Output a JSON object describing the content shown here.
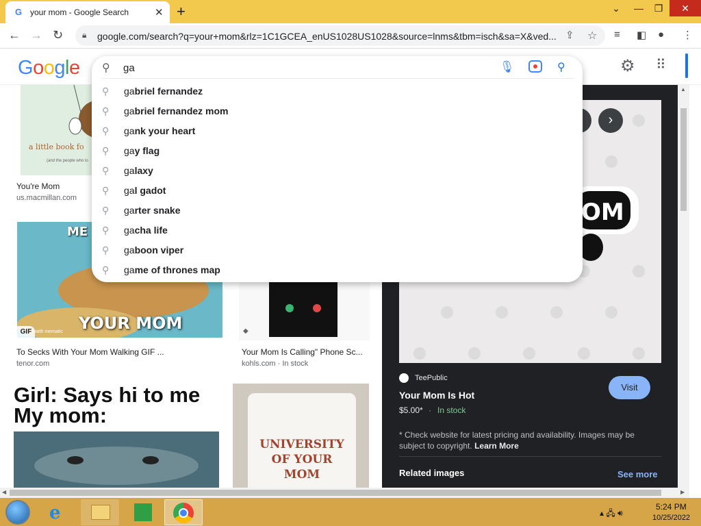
{
  "browser": {
    "tab_title": "your mom - Google Search",
    "tab_favicon": "G",
    "url": "google.com/search?q=your+mom&rlz=1C1GCEA_enUS1028US1028&source=lnms&tbm=isch&sa=X&ved...",
    "icons": [
      "back-icon",
      "forward-icon",
      "reload-icon",
      "lock-icon",
      "share-icon",
      "star-icon",
      "media-icon",
      "sidepanel-icon",
      "profile-icon",
      "menu-icon"
    ]
  },
  "google": {
    "logo": "Google",
    "logo_colors": [
      "#4285f4",
      "#ea4335",
      "#fbbc05",
      "#4285f4",
      "#34a853",
      "#ea4335"
    ]
  },
  "search": {
    "query": "ga",
    "suggestions": [
      {
        "prefix": "ga",
        "rest": "briel fernandez"
      },
      {
        "prefix": "ga",
        "rest": "briel fernandez mom"
      },
      {
        "prefix": "ga",
        "rest": "nk your heart"
      },
      {
        "prefix": "ga",
        "rest": "y flag"
      },
      {
        "prefix": "ga",
        "rest": "laxy"
      },
      {
        "prefix": "ga",
        "rest": "l gadot"
      },
      {
        "prefix": "ga",
        "rest": "rter snake"
      },
      {
        "prefix": "ga",
        "rest": "cha life"
      },
      {
        "prefix": "ga",
        "rest": "boon viper"
      },
      {
        "prefix": "ga",
        "rest": "me of thrones map"
      }
    ]
  },
  "results": [
    {
      "title": "You're Mom",
      "source": "us.macmillan.com",
      "image_text": "a little book fo",
      "image_subtext": "(and the people who lo"
    },
    {
      "title": "To Secks With Your Mom Walking GIF ...",
      "source": "tenor.com",
      "image_text_top": "ME C",
      "image_text": "YOUR MOM",
      "badge": "GIF",
      "badge_note": "with mematic"
    },
    {
      "title": "Your Mom Is Calling\" Phone Sc...",
      "source": "kohls.com",
      "stock": "In stock"
    },
    {
      "image_text": "Girl: Says hi to me\nMy mom:"
    },
    {
      "image_text": "UNIVERSITY\nOF YOUR\nMOM"
    }
  ],
  "preview": {
    "image_text": "OM",
    "site": "TeePublic",
    "title": "Your Mom Is Hot",
    "price": "$5.00*",
    "separator": "·",
    "stock": "In stock",
    "visit_label": "Visit",
    "note": "* Check website for latest pricing and availability. Images may be subject to copyright.",
    "learn_more": "Learn More",
    "related": "Related images",
    "see_more": "See more"
  },
  "taskbar": {
    "time": "5:24 PM",
    "date": "10/25/2022"
  }
}
